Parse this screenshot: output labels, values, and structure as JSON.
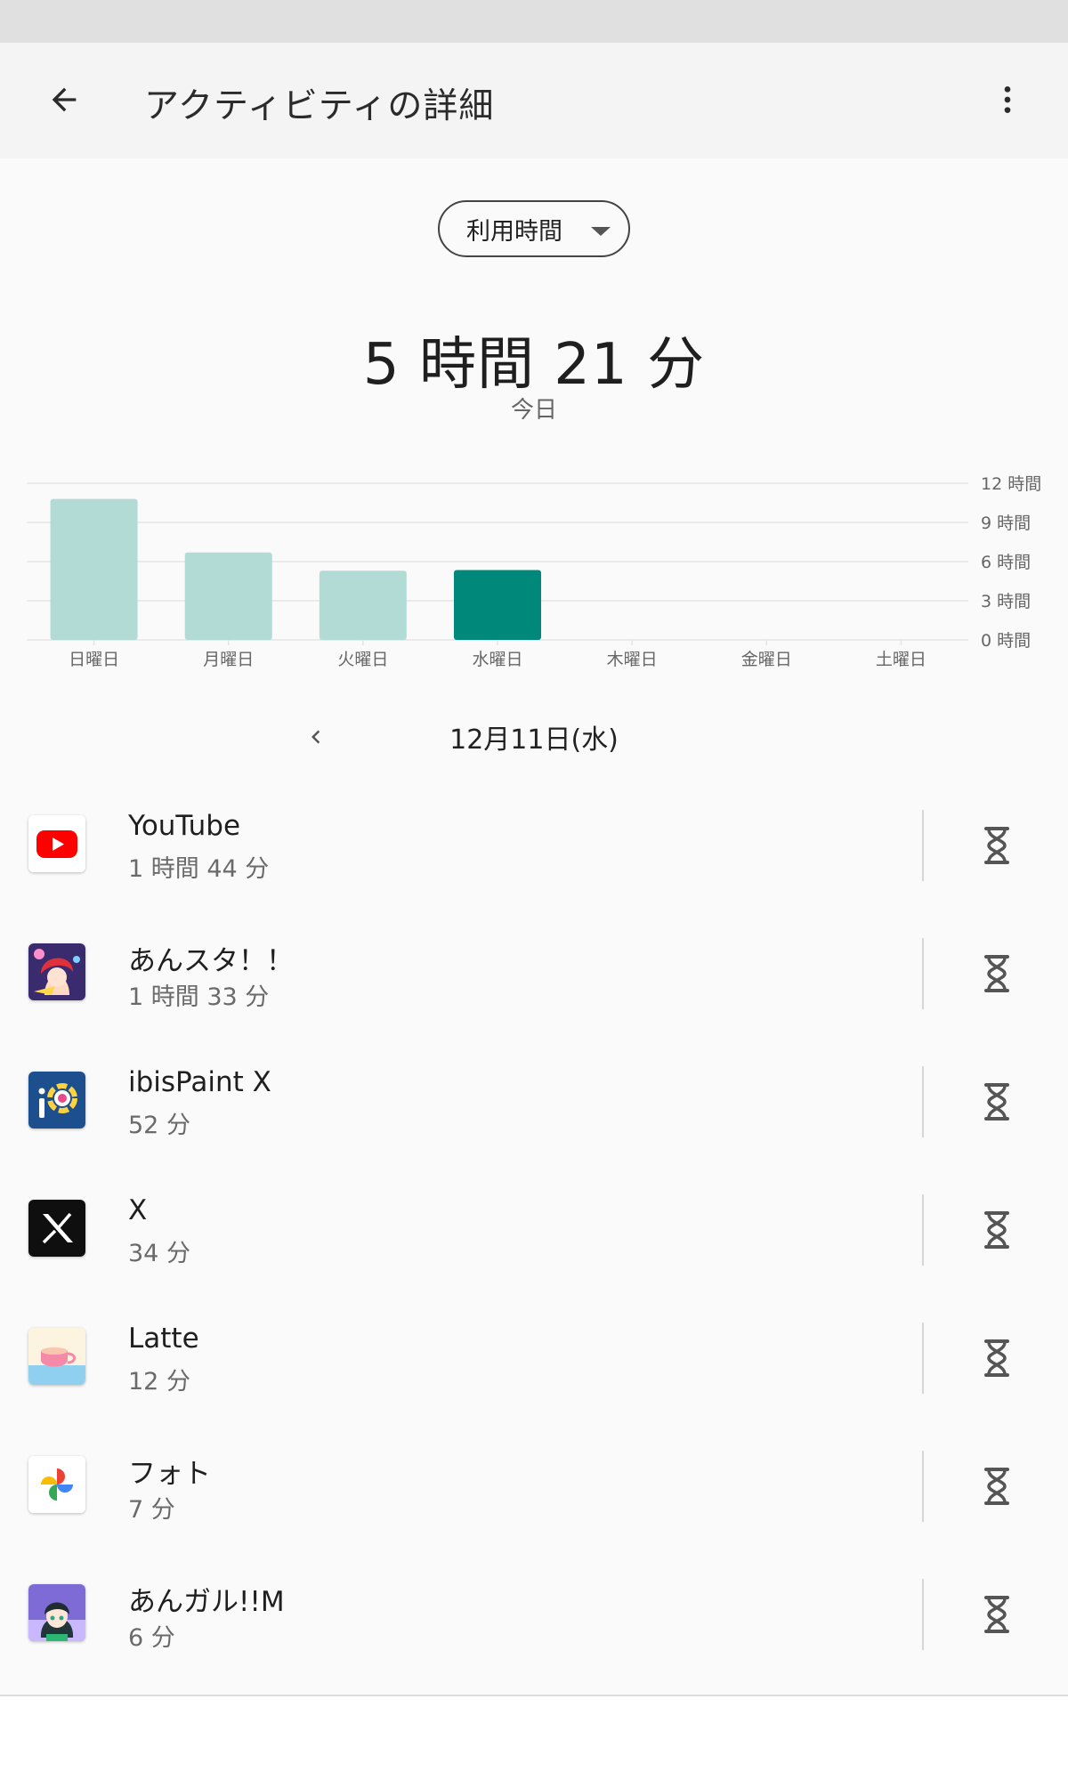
{
  "app_bar": {
    "title": "アクティビティの詳細",
    "back_icon": "arrow-back-icon",
    "more_icon": "more-vert-icon"
  },
  "metric_selector": {
    "value": "利用時間"
  },
  "summary": {
    "total": "5 時間 21 分",
    "period": "今日"
  },
  "chart_data": {
    "type": "bar",
    "categories": [
      "日曜日",
      "月曜日",
      "火曜日",
      "水曜日",
      "木曜日",
      "金曜日",
      "土曜日"
    ],
    "values": [
      10.8,
      6.7,
      5.3,
      5.35,
      0,
      0,
      0
    ],
    "ylim": [
      0,
      12
    ],
    "yticks": [
      {
        "value": 0,
        "label": "0 時間"
      },
      {
        "value": 3,
        "label": "3 時間"
      },
      {
        "value": 6,
        "label": "6 時間"
      },
      {
        "value": 9,
        "label": "9 時間"
      },
      {
        "value": 12,
        "label": "12 時間"
      }
    ],
    "highlight_index": 3,
    "colors": {
      "bar": "#b2dbd5",
      "bar_selected": "#00897b",
      "grid": "#e4e4e4",
      "axis_text": "#666666"
    },
    "grid": true
  },
  "date_nav": {
    "label": "12月11日(水)",
    "prev_icon": "chevron-left-icon"
  },
  "apps": [
    {
      "name": "YouTube",
      "usage": "1 時間 44 分",
      "icon": "youtube-icon"
    },
    {
      "name": "あんスタ！！",
      "usage": "1 時間 33 分",
      "icon": "ansta-icon"
    },
    {
      "name": "ibisPaint X",
      "usage": "52 分",
      "icon": "ibispaint-icon"
    },
    {
      "name": "X",
      "usage": "34 分",
      "icon": "x-icon"
    },
    {
      "name": "Latte",
      "usage": "12 分",
      "icon": "latte-icon"
    },
    {
      "name": "フォト",
      "usage": "7 分",
      "icon": "photos-icon"
    },
    {
      "name": "あんガル!!M",
      "usage": "6 分",
      "icon": "angaru-icon"
    }
  ],
  "timer_icon": "hourglass-icon"
}
